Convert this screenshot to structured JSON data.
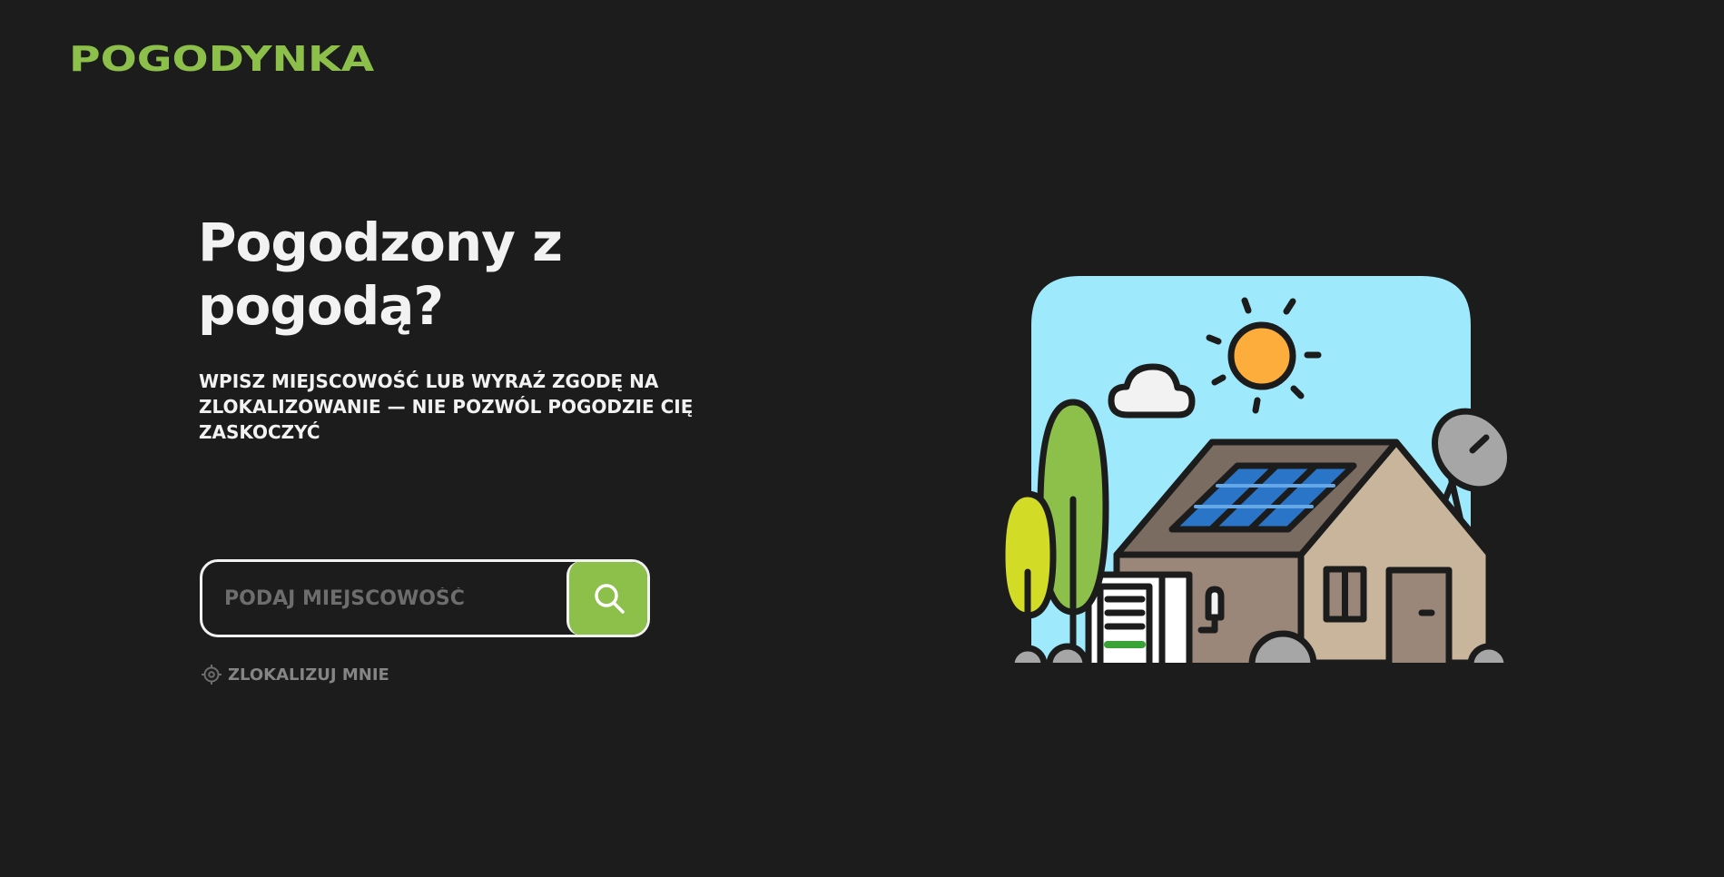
{
  "brand": {
    "logo_text": "POGODYNKA",
    "accent_color": "#8cc04b"
  },
  "hero": {
    "title": "Pogodzony z pogodą?",
    "subtitle": "WPISZ MIEJSCOWOŚĆ LUB WYRAŹ ZGODĘ NA ZLOKALIZOWANIE — NIE POZWÓL POGODZIE CIĘ ZASKOCZYĆ"
  },
  "search": {
    "placeholder": "PODAJ MIEJSCOWOŚĆ",
    "value": "",
    "button_icon": "search-icon"
  },
  "locate": {
    "label": "ZLOKALIZUJ MNIE",
    "icon": "crosshair-icon"
  },
  "illustration": {
    "subject": "house-with-solar-panels",
    "colors": {
      "sky": "#9fe9fc",
      "sun": "#fdad3c",
      "roof": "#7b6c62",
      "panel": "#2a75c7",
      "wall_left": "#9a877a",
      "wall_right": "#c8b59b",
      "tree_big": "#8cc04b",
      "tree_small": "#d2dc26",
      "dish": "#a6a6a6",
      "stroke": "#1c1c1c"
    }
  }
}
